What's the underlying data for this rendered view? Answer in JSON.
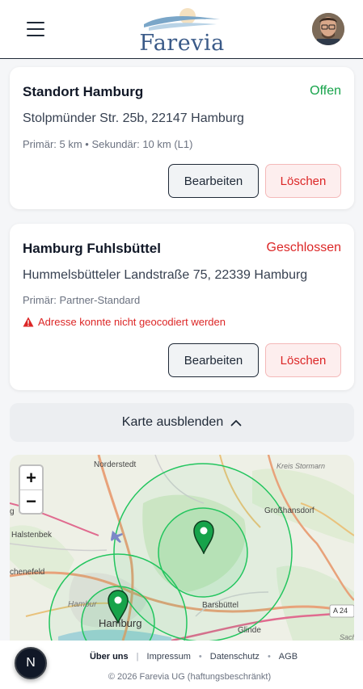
{
  "header": {
    "logo_text": "Farevia",
    "menu_icon": "hamburger-menu-icon",
    "avatar_icon": "user-avatar"
  },
  "locations": [
    {
      "name": "Standort Hamburg",
      "status": "Offen",
      "status_color": "#16a34a",
      "address": "Stolpmünder Str. 25b, 22147 Hamburg",
      "meta": "Primär: 5 km • Sekundär: 10 km (L1)",
      "error": "",
      "edit_label": "Bearbeiten",
      "delete_label": "Löschen"
    },
    {
      "name": "Hamburg Fuhlsbüttel",
      "status": "Geschlossen",
      "status_color": "#dc2626",
      "address": "Hummelsbütteler Landstraße 75, 22339 Hamburg",
      "meta": "Primär: Partner-Standard",
      "error": "Adresse konnte nicht geocodiert werden",
      "edit_label": "Bearbeiten",
      "delete_label": "Löschen"
    }
  ],
  "map_toggle": {
    "label": "Karte ausblenden",
    "icon": "chevron-up-icon"
  },
  "map": {
    "zoom_in": "+",
    "zoom_out": "−",
    "place_labels": {
      "norderstedt": "Norderstedt",
      "kreis_stormarn": "Kreis Stormarn",
      "grosshansdorf": "Großhansdorf",
      "halstenbek": "Halstenbek",
      "schenefeld": "chenefeld",
      "hamburg_dist": "Hambur",
      "hamburg": "Hamburg",
      "barsbuettel": "Barsbüttel",
      "glinde": "Glinde",
      "a24": "A 24",
      "sach": "Sach",
      "edge_g": "g"
    },
    "radius_color": "#22c55e",
    "marker_color": "#16a34a"
  },
  "footer": {
    "links": [
      "Über uns",
      "Impressum",
      "Datenschutz",
      "AGB"
    ],
    "separators": [
      "|",
      "•",
      "•"
    ],
    "copyright": "© 2026 Farevia UG (haftungsbeschränkt)",
    "fab_label": "N"
  }
}
